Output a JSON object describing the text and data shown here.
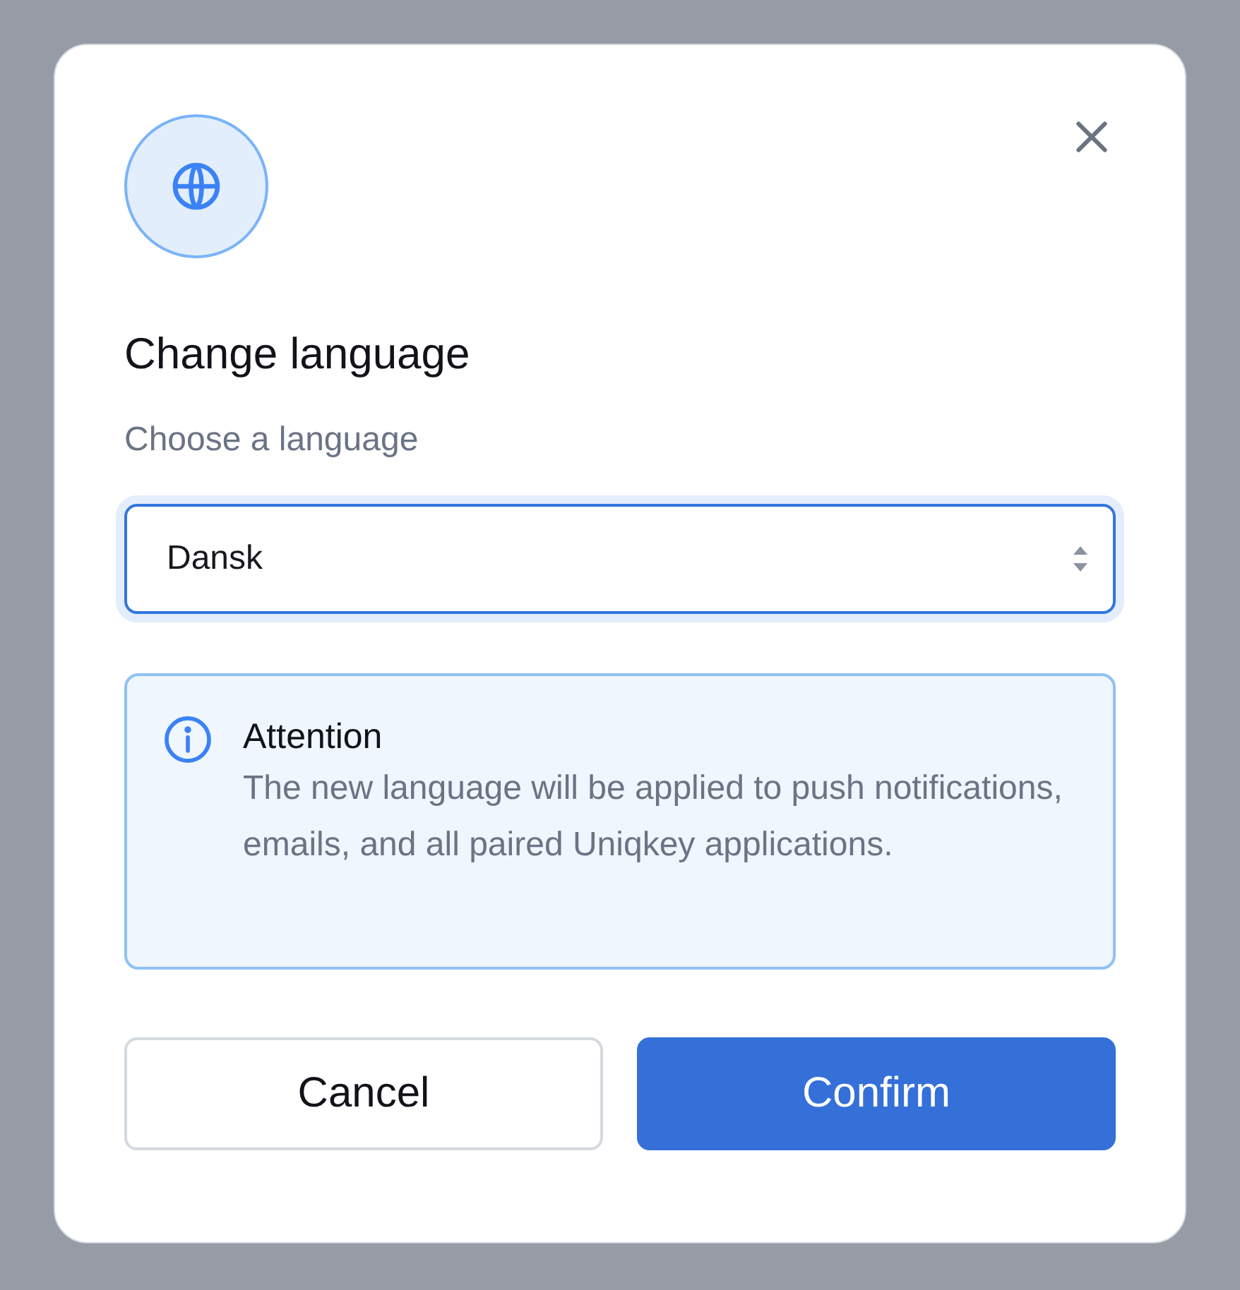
{
  "dialog": {
    "title": "Change language",
    "subtitle": "Choose a language",
    "select": {
      "value": "Dansk",
      "focused": true
    },
    "notice": {
      "title": "Attention",
      "text": "The new language will be applied to push notifications, emails, and all paired Uniqkey applications."
    },
    "buttons": [
      {
        "label": "Cancel",
        "kind": "secondary"
      },
      {
        "label": "Confirm",
        "kind": "primary"
      }
    ]
  }
}
